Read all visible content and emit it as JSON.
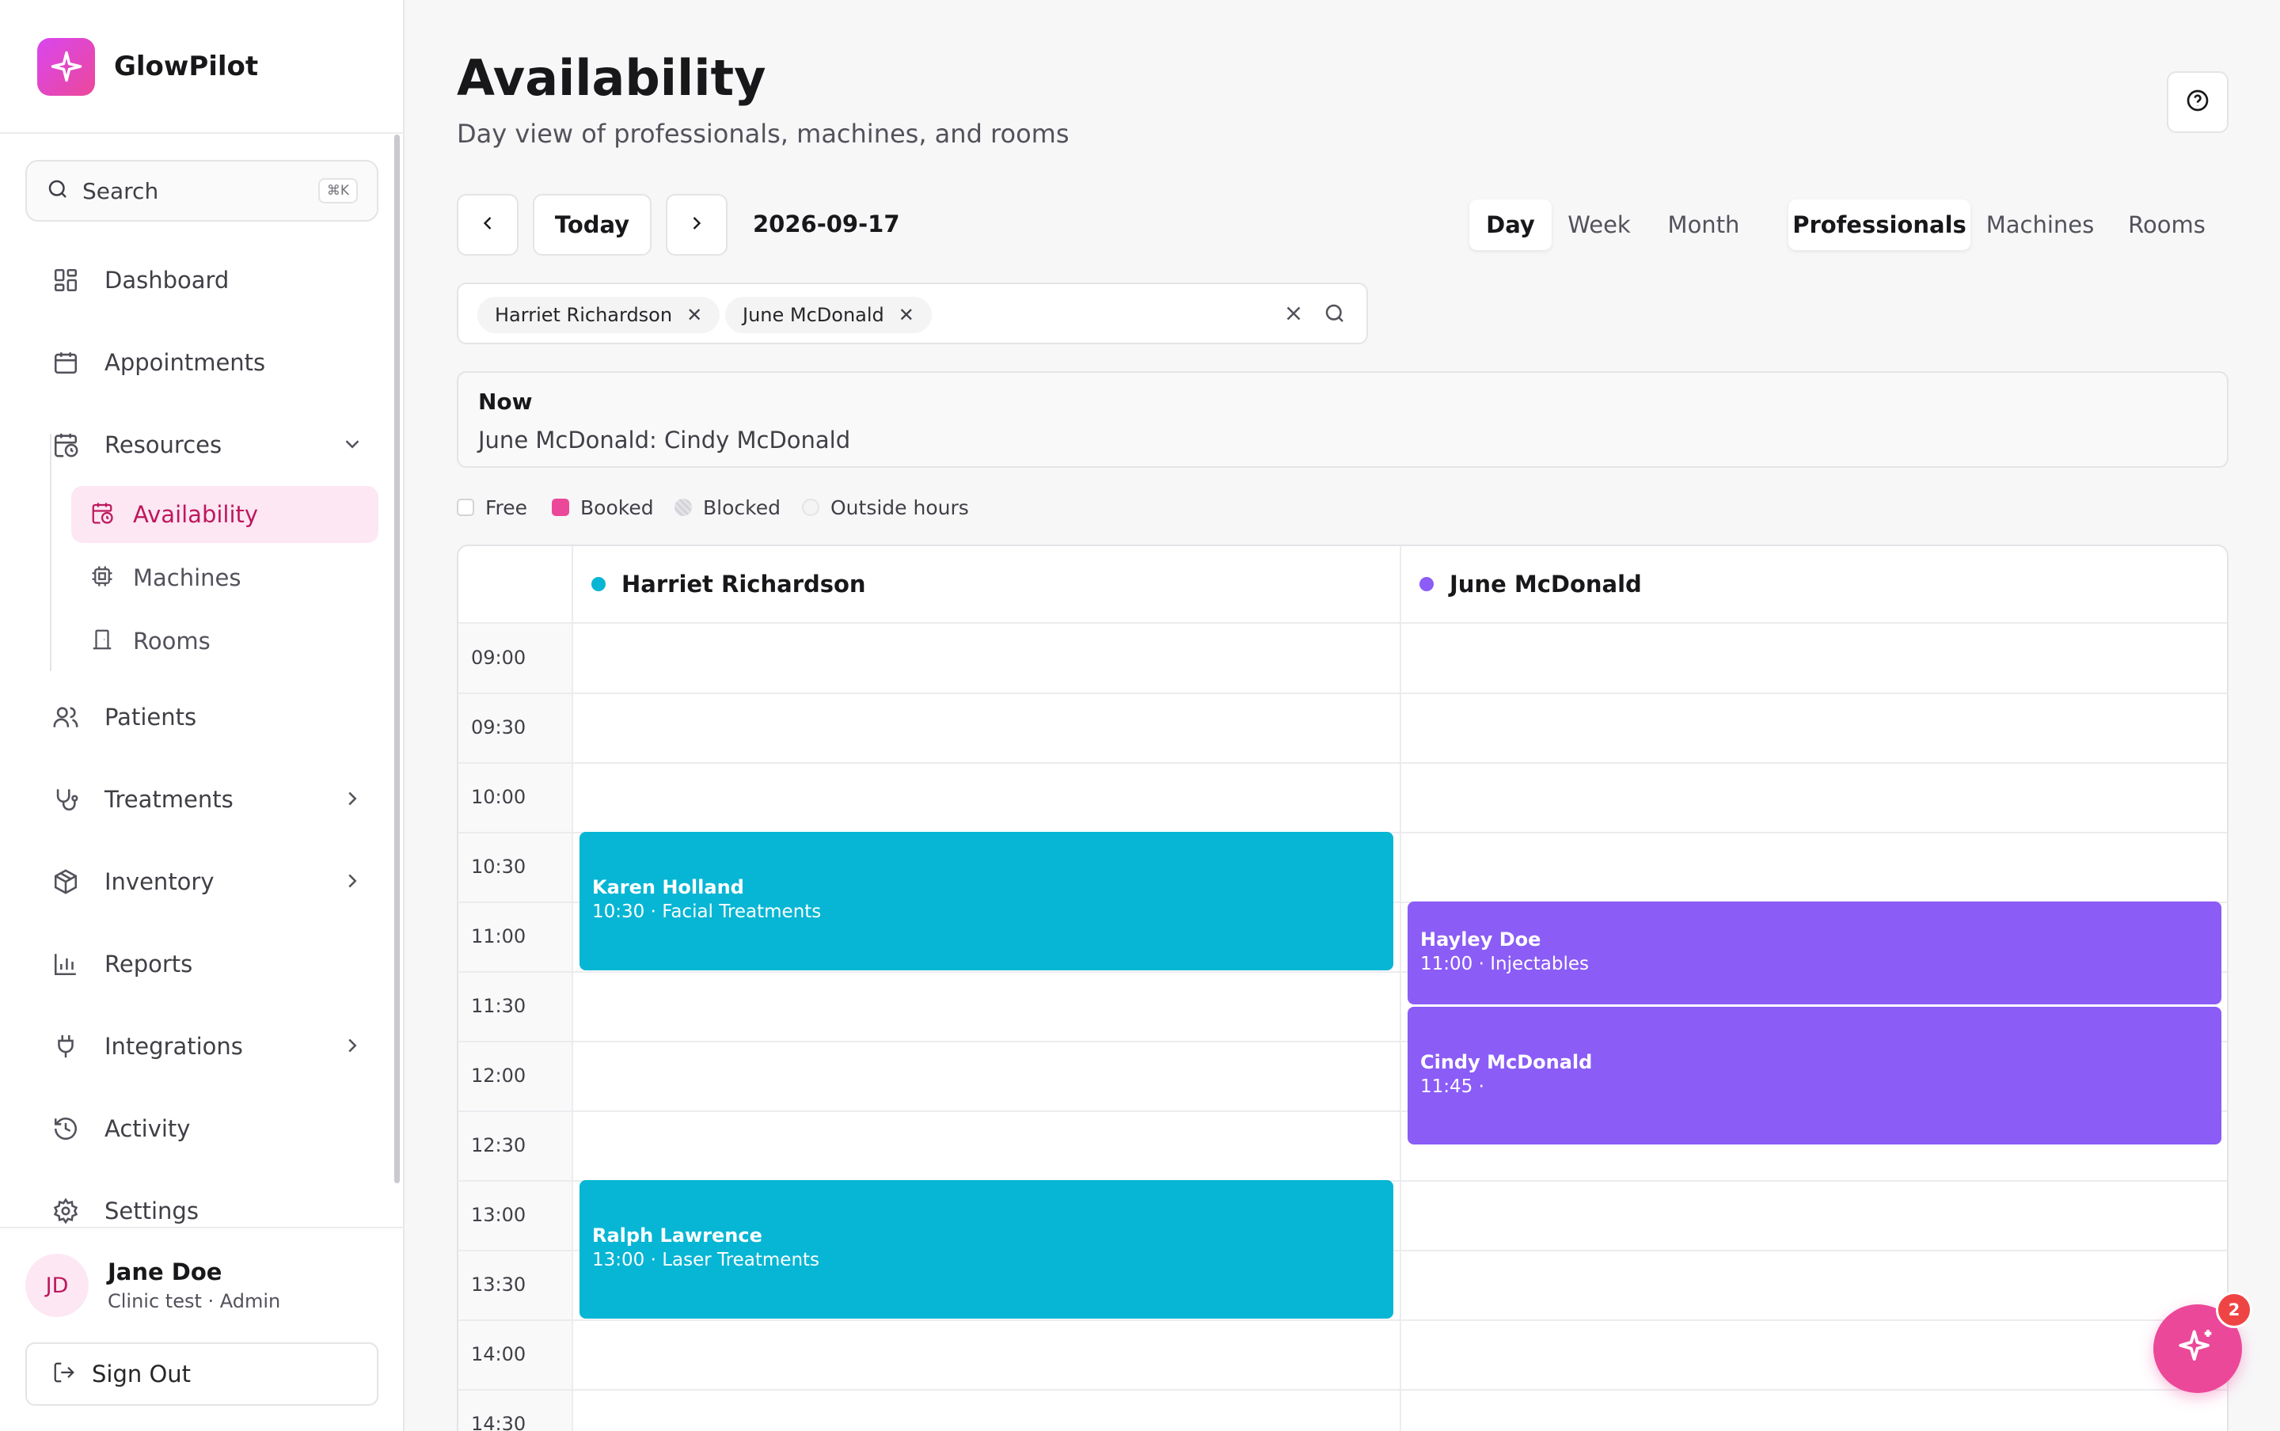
{
  "app": {
    "name": "GlowPilot"
  },
  "sidebar": {
    "search": {
      "label": "Search",
      "shortcut": "⌘K"
    },
    "items": [
      {
        "label": "Dashboard"
      },
      {
        "label": "Appointments"
      },
      {
        "label": "Resources"
      },
      {
        "label": "Patients"
      },
      {
        "label": "Treatments"
      },
      {
        "label": "Inventory"
      },
      {
        "label": "Reports"
      },
      {
        "label": "Integrations"
      },
      {
        "label": "Activity"
      },
      {
        "label": "Settings"
      }
    ],
    "resources_sub": [
      {
        "label": "Availability",
        "active": true
      },
      {
        "label": "Machines"
      },
      {
        "label": "Rooms"
      }
    ],
    "user": {
      "initials": "JD",
      "name": "Jane Doe",
      "subtitle": "Clinic test · Admin"
    },
    "sign_out": "Sign Out"
  },
  "header": {
    "title": "Availability",
    "subtitle": "Day view of professionals, machines, and rooms"
  },
  "toolbar": {
    "today": "Today",
    "date": "2026-09-17",
    "views": [
      "Day",
      "Week",
      "Month"
    ],
    "active_view": "Day",
    "resource_types": [
      "Professionals",
      "Machines",
      "Rooms"
    ],
    "active_resource_type": "Professionals"
  },
  "filter": {
    "chips": [
      "Harriet Richardson",
      "June McDonald"
    ]
  },
  "now": {
    "title": "Now",
    "text": "June McDonald: Cindy McDonald"
  },
  "legend": [
    {
      "label": "Free",
      "color": "#ffffff"
    },
    {
      "label": "Booked",
      "color": "#ec4899"
    },
    {
      "label": "Blocked",
      "color": "#d4d4d8"
    },
    {
      "label": "Outside hours",
      "color": "#f4f4f5"
    }
  ],
  "calendar": {
    "columns": [
      {
        "name": "Harriet Richardson",
        "color": "#06b6d4"
      },
      {
        "name": "June McDonald",
        "color": "#8b5cf6"
      }
    ],
    "times": [
      "09:00",
      "09:30",
      "10:00",
      "10:30",
      "11:00",
      "11:30",
      "12:00",
      "12:30",
      "13:00",
      "13:30",
      "14:00",
      "14:30"
    ],
    "appointments": [
      {
        "column": 0,
        "patient": "Karen Holland",
        "detail": "10:30 · Facial Treatments",
        "start": "10:30",
        "end": "11:30"
      },
      {
        "column": 0,
        "patient": "Ralph Lawrence",
        "detail": "13:00 · Laser Treatments",
        "start": "13:00",
        "end": "14:00"
      },
      {
        "column": 1,
        "patient": "Hayley Doe",
        "detail": "11:00 · Injectables",
        "start": "11:00",
        "end": "11:45"
      },
      {
        "column": 1,
        "patient": "Cindy McDonald",
        "detail": "11:45 ·",
        "start": "11:45",
        "end": "12:45"
      }
    ]
  },
  "assistant": {
    "badge": "2"
  }
}
